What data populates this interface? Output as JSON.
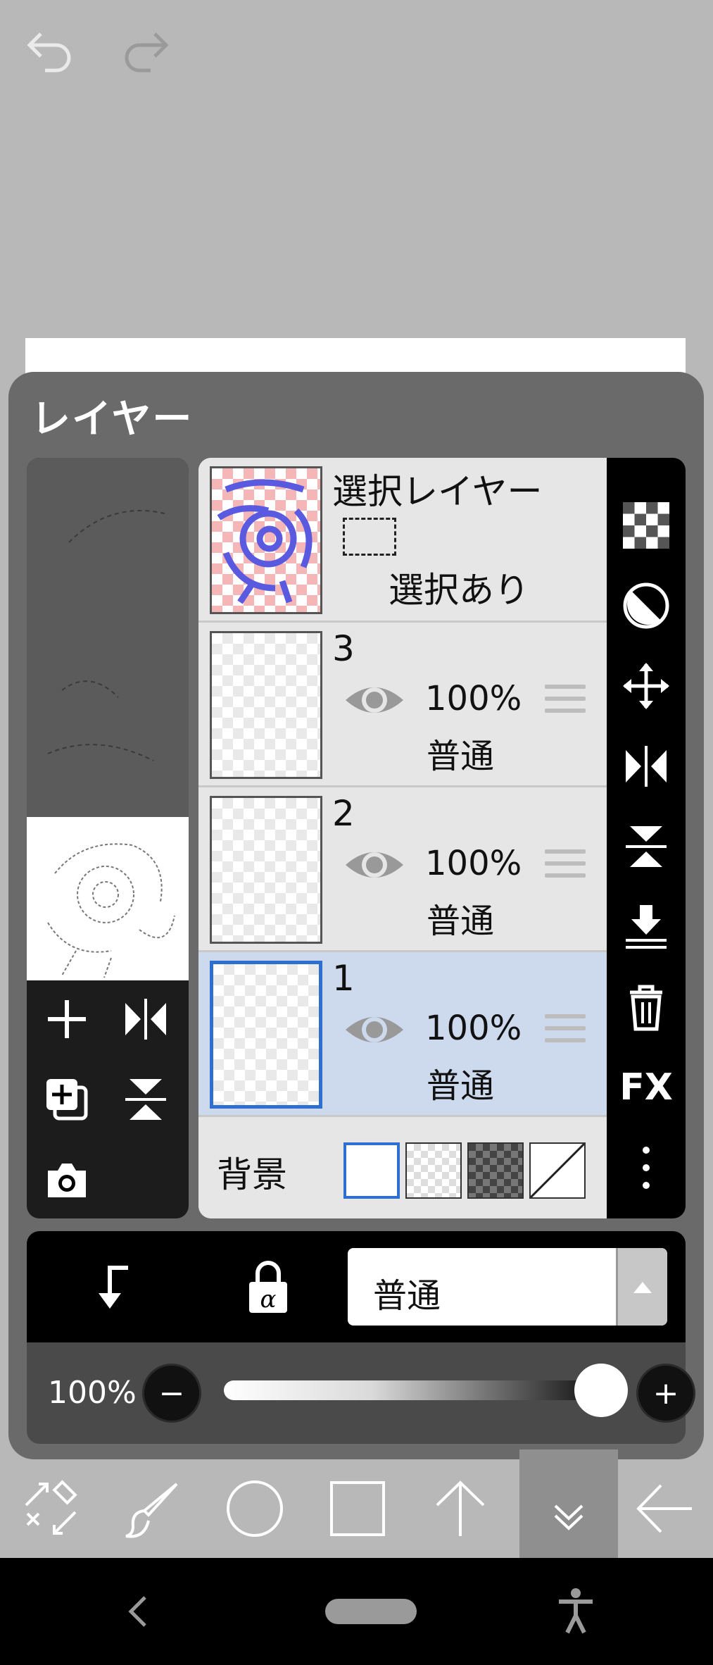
{
  "panel": {
    "title": "レイヤー"
  },
  "layers": [
    {
      "name": "選択レイヤー",
      "status": "選択あり",
      "kind": "selection"
    },
    {
      "number": "3",
      "opacity": "100%",
      "blend": "普通",
      "selected": false
    },
    {
      "number": "2",
      "opacity": "100%",
      "blend": "普通",
      "selected": false
    },
    {
      "number": "1",
      "opacity": "100%",
      "blend": "普通",
      "selected": true
    }
  ],
  "background": {
    "label": "背景",
    "options": [
      "white",
      "transparent",
      "dark-checker",
      "none"
    ],
    "selected": "white"
  },
  "blend_bar": {
    "mode": "普通"
  },
  "opacity_bar": {
    "value": "100%",
    "minus": "−",
    "plus": "+",
    "slider_fraction": 1.0
  },
  "right_tools": {
    "fx_label": "FX"
  },
  "colors": {
    "accent": "#2f6fd0",
    "selected_row": "#cdd9ec",
    "panel": "#6a6a6a",
    "thumb_pink": "#f4b6b6",
    "thumb_blue": "#5a5ae0"
  },
  "icons": [
    "undo-icon",
    "redo-icon",
    "add-layer-icon",
    "flip-horizontal-icon",
    "duplicate-layer-icon",
    "flip-vertical-icon",
    "camera-icon",
    "checker-icon",
    "invert-icon",
    "move-icon",
    "flip-h-tool-icon",
    "flip-v-tool-icon",
    "merge-down-icon",
    "trash-icon",
    "more-icon",
    "clip-arrow-icon",
    "alpha-lock-icon",
    "eye-icon",
    "drag-handle-icon",
    "transform-tool-icon",
    "brush-icon",
    "ellipse-icon",
    "rectangle-icon",
    "arrow-up-icon",
    "collapse-icon",
    "back-arrow-icon"
  ]
}
